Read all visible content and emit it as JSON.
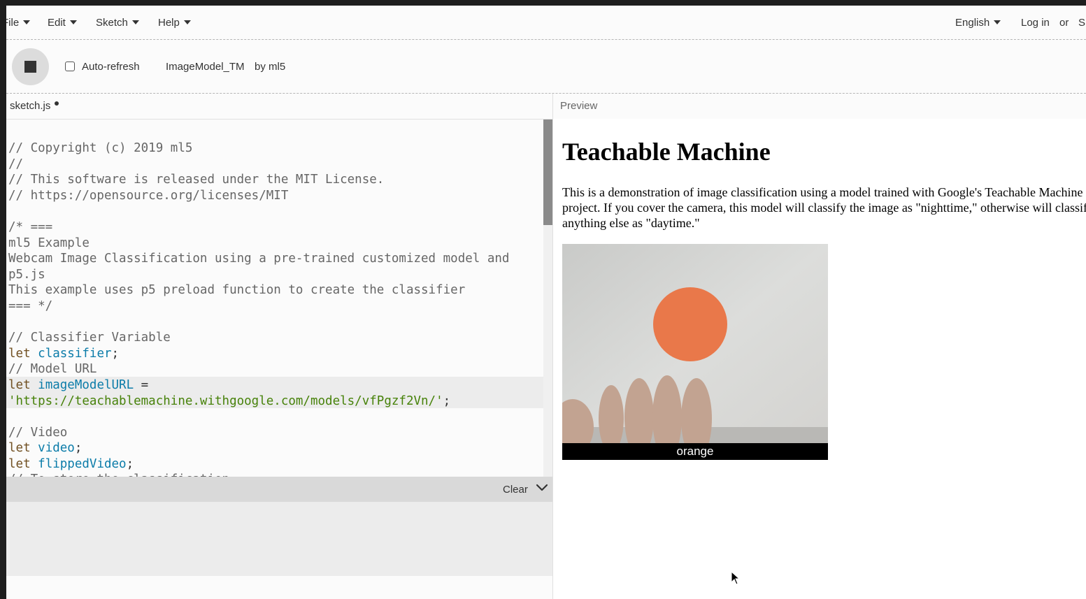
{
  "menubar": {
    "items": [
      {
        "label": "File"
      },
      {
        "label": "Edit"
      },
      {
        "label": "Sketch"
      },
      {
        "label": "Help"
      }
    ],
    "language": "English",
    "login": "Log in",
    "or": "or",
    "signup": "S"
  },
  "toolbar": {
    "auto_refresh_label": "Auto-refresh",
    "sketch_name": "ImageModel_TM",
    "owner": "by ml5"
  },
  "editor": {
    "file_tab": "sketch.js",
    "lines": [
      [
        {
          "t": "comment",
          "v": "// Copyright (c) 2019 ml5"
        }
      ],
      [
        {
          "t": "comment",
          "v": "//"
        }
      ],
      [
        {
          "t": "comment",
          "v": "// This software is released under the MIT License."
        }
      ],
      [
        {
          "t": "comment",
          "v": "// https://opensource.org/licenses/MIT"
        }
      ],
      [],
      [
        {
          "t": "comment",
          "v": "/* ==="
        }
      ],
      [
        {
          "t": "comment",
          "v": "ml5 Example"
        }
      ],
      [
        {
          "t": "comment",
          "v": "Webcam Image Classification using a pre-trained customized model and"
        }
      ],
      [
        {
          "t": "comment",
          "v": "p5.js"
        }
      ],
      [
        {
          "t": "comment",
          "v": "This example uses p5 preload function to create the classifier"
        }
      ],
      [
        {
          "t": "comment",
          "v": "=== */"
        }
      ],
      [],
      [
        {
          "t": "comment",
          "v": "// Classifier Variable"
        }
      ],
      [
        {
          "t": "keyword",
          "v": "let "
        },
        {
          "t": "var",
          "v": "classifier"
        },
        {
          "t": "plain",
          "v": ";"
        }
      ],
      [
        {
          "t": "comment",
          "v": "// Model URL"
        }
      ],
      [
        {
          "t": "keyword",
          "v": "let "
        },
        {
          "t": "var",
          "v": "imageModelURL"
        },
        {
          "t": "plain",
          "v": " ="
        }
      ],
      [
        {
          "t": "string",
          "v": "'https://teachablemachine.withgoogle.com/models/vfPgzf2Vn/'"
        },
        {
          "t": "plain",
          "v": ";"
        }
      ],
      [],
      [
        {
          "t": "comment",
          "v": "// Video"
        }
      ],
      [
        {
          "t": "keyword",
          "v": "let "
        },
        {
          "t": "var",
          "v": "video"
        },
        {
          "t": "plain",
          "v": ";"
        }
      ],
      [
        {
          "t": "keyword",
          "v": "let "
        },
        {
          "t": "var",
          "v": "flippedVideo"
        },
        {
          "t": "plain",
          "v": ";"
        }
      ],
      [
        {
          "t": "comment",
          "v": "// To store the classification"
        }
      ]
    ]
  },
  "console": {
    "clear_label": "Clear"
  },
  "preview": {
    "label": "Preview",
    "title": "Teachable Machine",
    "description": "This is a demonstration of image classification using a model trained with Google's Teachable Machine project. If you cover the camera, this model will classify the image as \"nighttime,\" otherwise will classify anything else as \"daytime.\"",
    "prediction_label": "orange"
  },
  "colors": {
    "comment": "#666666",
    "keyword": "#704f21",
    "variable": "#0b7ca9",
    "string": "#47820a",
    "orange_disc": "#e9784a"
  }
}
